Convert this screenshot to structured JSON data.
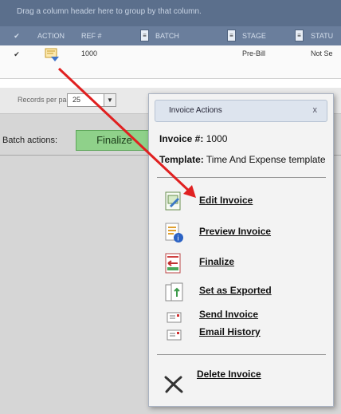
{
  "grid": {
    "group_hint": "Drag a column header here to group by that column.",
    "columns": [
      "ACTION",
      "REF #",
      "BATCH",
      "STAGE",
      "STATU"
    ],
    "row": {
      "ref": "1000",
      "batch": "",
      "stage": "Pre-Bill",
      "status": "Not Se"
    }
  },
  "pager": {
    "label": "Records per page:",
    "value": "25"
  },
  "batch": {
    "label": "Batch actions:",
    "finalize_label": "Finalize"
  },
  "popup": {
    "title": "Invoice Actions",
    "close": "x",
    "invoice_label": "Invoice #:",
    "invoice_value": "1000",
    "template_label": "Template:",
    "template_value": "Time And Expense template",
    "actions": [
      {
        "label": "Edit Invoice",
        "icon": "edit-invoice-icon"
      },
      {
        "label": "Preview Invoice",
        "icon": "preview-invoice-icon"
      },
      {
        "label": "Finalize",
        "icon": "finalize-icon"
      },
      {
        "label": "Set as Exported",
        "icon": "export-icon"
      },
      {
        "label": "Send Invoice",
        "icon": "send-email-icon"
      },
      {
        "label": "Email History",
        "icon": "email-history-icon"
      }
    ],
    "delete_label": "Delete Invoice"
  },
  "colors": {
    "header": "#6a7e9c",
    "accent_arrow": "#e02020",
    "finalize_btn": "#8fd18a"
  }
}
